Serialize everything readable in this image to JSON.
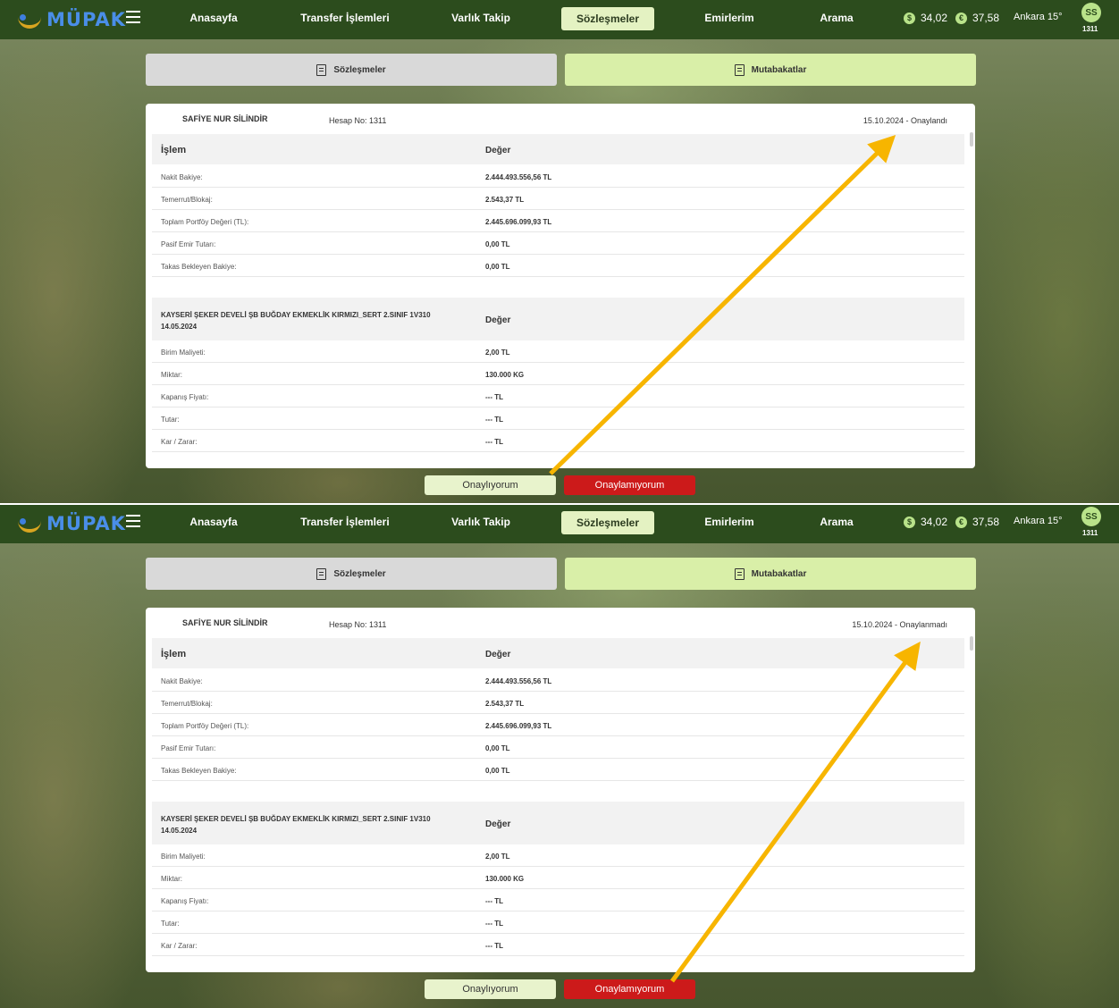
{
  "screens": [
    {
      "logo": "MÜPAK",
      "nav": [
        "Anasayfa",
        "Transfer İşlemleri",
        "Varlık Takip",
        "Sözleşmeler",
        "Emirlerim",
        "Arama"
      ],
      "rates": [
        "34,02",
        "37,58"
      ],
      "weather": "Ankara 15°",
      "avatar": "SS",
      "avatar_sub": "1311",
      "tabs": [
        "Sözleşmeler",
        "Mutabakatlar"
      ],
      "customer": "SAFİYE NUR SİLİNDİR",
      "account": "Hesap No: 1311",
      "status": "15.10.2024 - Onaylandı",
      "section1": {
        "col1": "İşlem",
        "col2": "Değer",
        "rows": [
          {
            "k": "Nakit Bakiye:",
            "v": "2.444.493.556,56 TL"
          },
          {
            "k": "Temerrut/Blokaj:",
            "v": "2.543,37 TL"
          },
          {
            "k": "Toplam Portföy Değeri (TL):",
            "v": "2.445.696.099,93 TL"
          },
          {
            "k": "Pasif Emir Tutarı:",
            "v": "0,00 TL"
          },
          {
            "k": "Takas Bekleyen Bakiye:",
            "v": "0,00 TL"
          }
        ]
      },
      "section2": {
        "col1": "KAYSERİ ŞEKER DEVELİ ŞB BUĞDAY EKMEKLİK KIRMIZI_SERT 2.SINIF 1V310",
        "col1b": "14.05.2024",
        "col2": "Değer",
        "rows": [
          {
            "k": "Birim Maliyeti:",
            "v": "2,00 TL"
          },
          {
            "k": "Miktar:",
            "v": "130.000 KG"
          },
          {
            "k": "Kapanış Fiyatı:",
            "v": "--- TL"
          },
          {
            "k": "Tutar:",
            "v": "--- TL"
          },
          {
            "k": "Kar / Zarar:",
            "v": "--- TL"
          }
        ]
      },
      "btn_ok": "Onaylıyorum",
      "btn_no": "Onaylamıyorum"
    },
    {
      "logo": "MÜPAK",
      "nav": [
        "Anasayfa",
        "Transfer İşlemleri",
        "Varlık Takip",
        "Sözleşmeler",
        "Emirlerim",
        "Arama"
      ],
      "rates": [
        "34,02",
        "37,58"
      ],
      "weather": "Ankara 15°",
      "avatar": "SS",
      "avatar_sub": "1311",
      "tabs": [
        "Sözleşmeler",
        "Mutabakatlar"
      ],
      "customer": "SAFİYE NUR SİLİNDİR",
      "account": "Hesap No: 1311",
      "status": "15.10.2024 - Onaylanmadı",
      "section1": {
        "col1": "İşlem",
        "col2": "Değer",
        "rows": [
          {
            "k": "Nakit Bakiye:",
            "v": "2.444.493.556,56 TL"
          },
          {
            "k": "Temerrut/Blokaj:",
            "v": "2.543,37 TL"
          },
          {
            "k": "Toplam Portföy Değeri (TL):",
            "v": "2.445.696.099,93 TL"
          },
          {
            "k": "Pasif Emir Tutarı:",
            "v": "0,00 TL"
          },
          {
            "k": "Takas Bekleyen Bakiye:",
            "v": "0,00 TL"
          }
        ]
      },
      "section2": {
        "col1": "KAYSERİ ŞEKER DEVELİ ŞB BUĞDAY EKMEKLİK KIRMIZI_SERT 2.SINIF 1V310",
        "col1b": "14.05.2024",
        "col2": "Değer",
        "rows": [
          {
            "k": "Birim Maliyeti:",
            "v": "2,00 TL"
          },
          {
            "k": "Miktar:",
            "v": "130.000 KG"
          },
          {
            "k": "Kapanış Fiyatı:",
            "v": "--- TL"
          },
          {
            "k": "Tutar:",
            "v": "--- TL"
          },
          {
            "k": "Kar / Zarar:",
            "v": "--- TL"
          }
        ]
      },
      "btn_ok": "Onaylıyorum",
      "btn_no": "Onaylamıyorum"
    }
  ],
  "colors": {
    "topbar": "#2c4c1d",
    "active_nav": "#e4f2c2",
    "tab_inactive": "#d9d9d9",
    "tab_active": "#d9efa8",
    "approve_button": "#e8f3cc",
    "reject_button": "#cc1a1a",
    "annotation_arrow": "#f7b500"
  }
}
